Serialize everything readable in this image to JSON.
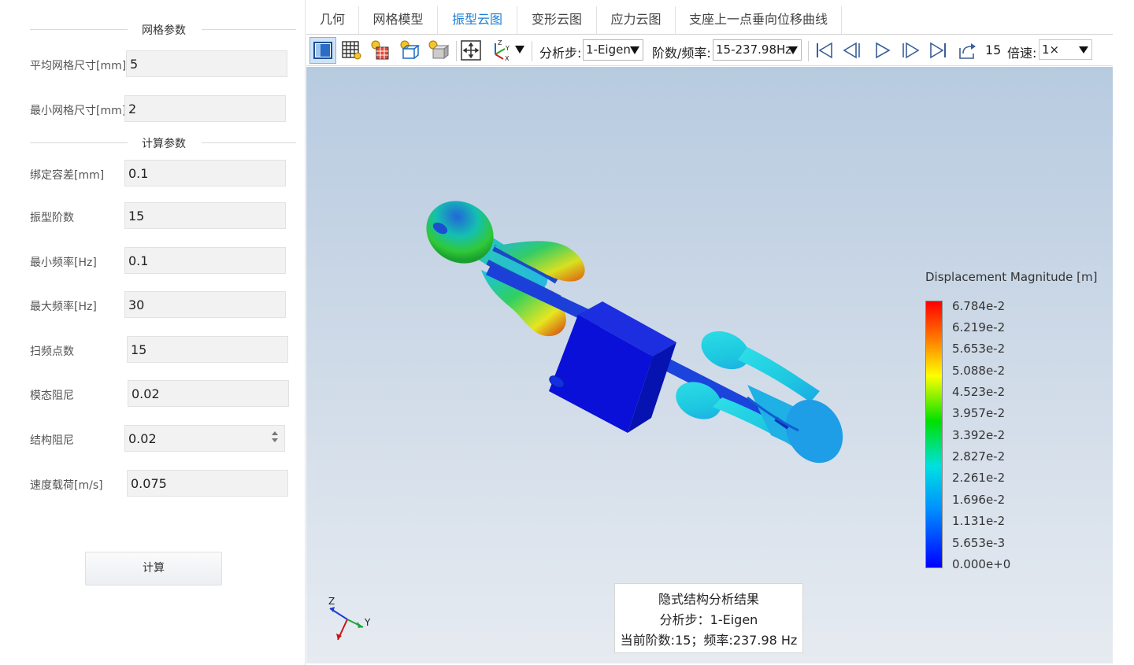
{
  "left_panel": {
    "mesh_section_title": "网格参数",
    "calc_section_title": "计算参数",
    "mesh_params": [
      {
        "label": "平均网格尺寸[mm]",
        "value": "5"
      },
      {
        "label": "最小网格尺寸[mm]",
        "value": "2"
      }
    ],
    "calc_params": [
      {
        "label": "绑定容差[mm]",
        "value": "0.1"
      },
      {
        "label": "振型阶数",
        "value": "15"
      },
      {
        "label": "最小频率[Hz]",
        "value": "0.1"
      },
      {
        "label": "最大频率[Hz]",
        "value": "30"
      },
      {
        "label": "扫频点数",
        "value": "15"
      },
      {
        "label": "模态阻尼",
        "value": "0.02"
      },
      {
        "label": "结构阻尼",
        "value": "0.02"
      },
      {
        "label": "速度载荷[m/s]",
        "value": "0.075"
      }
    ],
    "calc_button": "计算"
  },
  "tabs": [
    {
      "label": "几何",
      "active": false
    },
    {
      "label": "网格模型",
      "active": false
    },
    {
      "label": "振型云图",
      "active": true
    },
    {
      "label": "变形云图",
      "active": false
    },
    {
      "label": "应力云图",
      "active": false
    },
    {
      "label": "支座上一点垂向位移曲线",
      "active": false
    }
  ],
  "toolbar": {
    "icons": [
      "solid-view-icon",
      "mesh-view-icon",
      "light-mesh-icon",
      "wireframe-icon",
      "light-box-icon",
      "fit-view-icon",
      "axis-view-icon"
    ],
    "analysis_step_label": "分析步:",
    "analysis_step_value": "1-Eigen",
    "order_freq_label": "阶数/频率:",
    "order_freq_value": "15-237.98Hz",
    "frame_number": "15",
    "speed_label": "倍速:",
    "speed_value": "1×"
  },
  "legend": {
    "title": "Displacement Magnitude [m]",
    "ticks": [
      "6.784e-2",
      "6.219e-2",
      "5.653e-2",
      "5.088e-2",
      "4.523e-2",
      "3.957e-2",
      "3.392e-2",
      "2.827e-2",
      "2.261e-2",
      "1.696e-2",
      "1.131e-2",
      "5.653e-3",
      "0.000e+0"
    ],
    "colors": {
      "max": "#ff0000",
      "mid": "#00e000",
      "min": "#0000ff"
    }
  },
  "info_box": {
    "line1": "隐式结构分析结果",
    "line2": "分析步：1-Eigen",
    "line3": "当前阶数:15；频率:237.98 Hz"
  },
  "triad": {
    "z": "Z",
    "y": "Y"
  },
  "accent_color": "#1e7fd6"
}
